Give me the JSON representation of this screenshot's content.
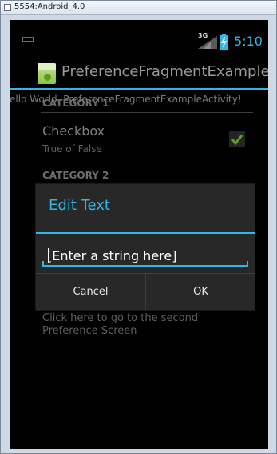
{
  "window": {
    "title": "5554:Android_4.0"
  },
  "status_bar": {
    "network": "3G",
    "time": "5:10",
    "icons": [
      "keyboard-icon",
      "signal-icon",
      "battery-icon"
    ]
  },
  "action_bar": {
    "title": "PreferenceFragmentExample"
  },
  "activity": {
    "hello_text": "Hello World, PreferenceFragmentExampleActivity!",
    "category1": "CATEGORY 1",
    "checkbox_title": "Checkbox",
    "checkbox_summary": "True of False",
    "checkbox_checked": true,
    "category2": "CATEGORY 2",
    "second_screen_text": "Click here to go to the second Preference Screen"
  },
  "dialog": {
    "title": "Edit Text",
    "input_placeholder": "[Enter a string here]",
    "input_value": "",
    "cancel_label": "Cancel",
    "ok_label": "OK"
  },
  "colors": {
    "accent": "#33b5e5",
    "screen_bg": "#000000",
    "dialog_bg": "#282828"
  }
}
